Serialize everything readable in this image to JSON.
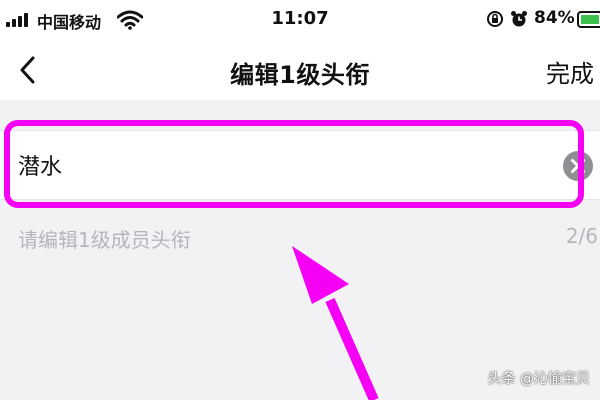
{
  "status_bar": {
    "carrier": "中国移动",
    "time": "11:07",
    "battery_percent": "84%",
    "battery_level": 0.84,
    "icons": [
      "signal-icon",
      "wifi-icon",
      "rotation-lock-icon",
      "alarm-icon",
      "battery-icon"
    ]
  },
  "nav": {
    "title": "编辑1级头衔",
    "done_label": "完成",
    "back_icon": "chevron-left-icon"
  },
  "form": {
    "value": "潜水",
    "hint": "请编辑1级成员头衔",
    "counter": "2/6",
    "clear_icon": "clear-circle-icon"
  },
  "annotation": {
    "highlight_color": "#f500f5"
  },
  "watermark": "头条 @沁愉宝贝",
  "colors": {
    "accent_battery": "#3cc24c",
    "hint_text": "#b5b5bb",
    "page_background": "#f2f2f4"
  }
}
